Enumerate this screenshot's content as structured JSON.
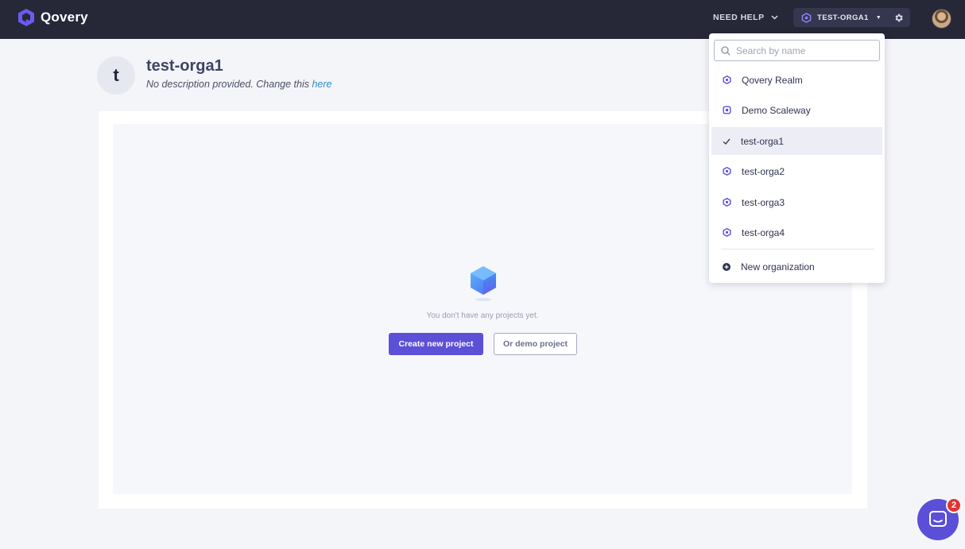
{
  "app": {
    "name": "Qovery"
  },
  "topbar": {
    "help_label": "NEED HELP",
    "org_switch_label": "TEST-ORGA1"
  },
  "organization": {
    "initial": "t",
    "name": "test-orga1",
    "description": "No description provided. Change this ",
    "description_link": "here"
  },
  "empty_state": {
    "message": "You don't have any projects yet.",
    "primary_button": "Create new project",
    "secondary_button": "Or demo project"
  },
  "dropdown": {
    "search_placeholder": "Search by name",
    "items": [
      {
        "label": "Qovery Realm",
        "icon": "org-icon",
        "selected": false
      },
      {
        "label": "Demo Scaleway",
        "icon": "scaleway-icon",
        "selected": false
      },
      {
        "label": "test-orga1",
        "icon": "check-icon",
        "selected": true
      },
      {
        "label": "test-orga2",
        "icon": "org-icon",
        "selected": false
      },
      {
        "label": "test-orga3",
        "icon": "org-icon",
        "selected": false
      },
      {
        "label": "test-orga4",
        "icon": "org-icon",
        "selected": false
      }
    ],
    "new_org_label": "New organization"
  },
  "chat": {
    "badge_count": "2"
  },
  "colors": {
    "brand": "#5b50d6",
    "topbar": "#262838",
    "badge": "#e53330",
    "link": "#2e8dc9"
  }
}
